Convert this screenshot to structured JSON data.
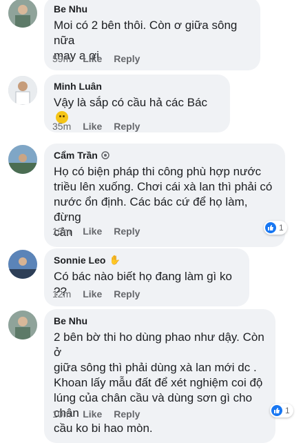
{
  "comments": [
    {
      "name": "Be Nhu",
      "text": "Moi có 2 bên thôi.  Còn ơ giữa sông nữa\nmay a ơi",
      "time": "59m",
      "like": "Like",
      "reply": "Reply"
    },
    {
      "name": "Minh Luân",
      "text": "Vậy là sắp có cầu hả các Bác",
      "emoji": "thinking-face",
      "time": "35m",
      "like": "Like",
      "reply": "Reply"
    },
    {
      "name": "Cẩm Trần",
      "badge": "top-fan-icon",
      "text": "Họ có biện pháp thi công phù hợp nước\ntriều lên xuống. Chơi cái xà lan thì phải có\nnước ổn định. Các bác cứ để họ làm, đừng\ncản",
      "time": "13m",
      "like": "Like",
      "reply": "Reply",
      "reactions": "1"
    },
    {
      "name": "Sonnie Leo",
      "badge": "wave-hand-icon",
      "text": "Có bác nào biết họ đang làm gì ko ??",
      "time": "12m",
      "like": "Like",
      "reply": "Reply"
    },
    {
      "name": "Be Nhu",
      "text": "2 bên bờ thi ho dùng phao như dậy. Còn ở\ngiữa sông thì phải dùng xà lan mới dc .\nKhoan lấy mẫu đất để xét nghiệm coi độ\nlúng của chân cầu và dùng sơn gì cho chân\ncầu ko bi hao mòn.",
      "time": "10m",
      "like": "Like",
      "reply": "Reply",
      "reactions": "1"
    }
  ],
  "colors": {
    "bubble": "#f0f2f5",
    "meta": "#65676b",
    "like_blue": "#1877f2"
  }
}
